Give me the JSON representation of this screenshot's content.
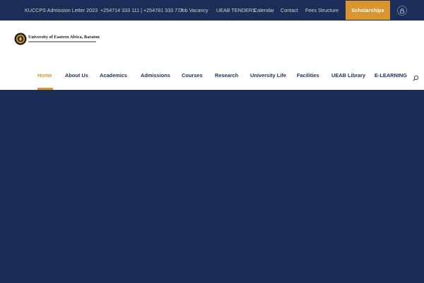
{
  "topbar": {
    "links": [
      "KUCCPS Admission Letter 2023",
      "+254714 333 111 | +254781 333 777",
      "Job Vacancy",
      "UEAB TENDERS",
      "Calendar",
      "Contact",
      "Fees Structure"
    ],
    "scholarships_label": "Scholarships",
    "account_icon": "lock-icon"
  },
  "header": {
    "logo_title": "University of Eastern Africa, Baraton",
    "nav": [
      "Home",
      "About Us",
      "Academics",
      "Admissions",
      "Courses",
      "Research",
      "University Life",
      "Facilities",
      "UEAB Library",
      "E-LEARNING"
    ],
    "active_nav": "Home",
    "search_icon": "search-icon"
  },
  "colors": {
    "navy": "#1c2d57",
    "accent": "#d9952f",
    "nav_text": "#1f2f5c",
    "topbar_text": "#c9cfdc"
  }
}
